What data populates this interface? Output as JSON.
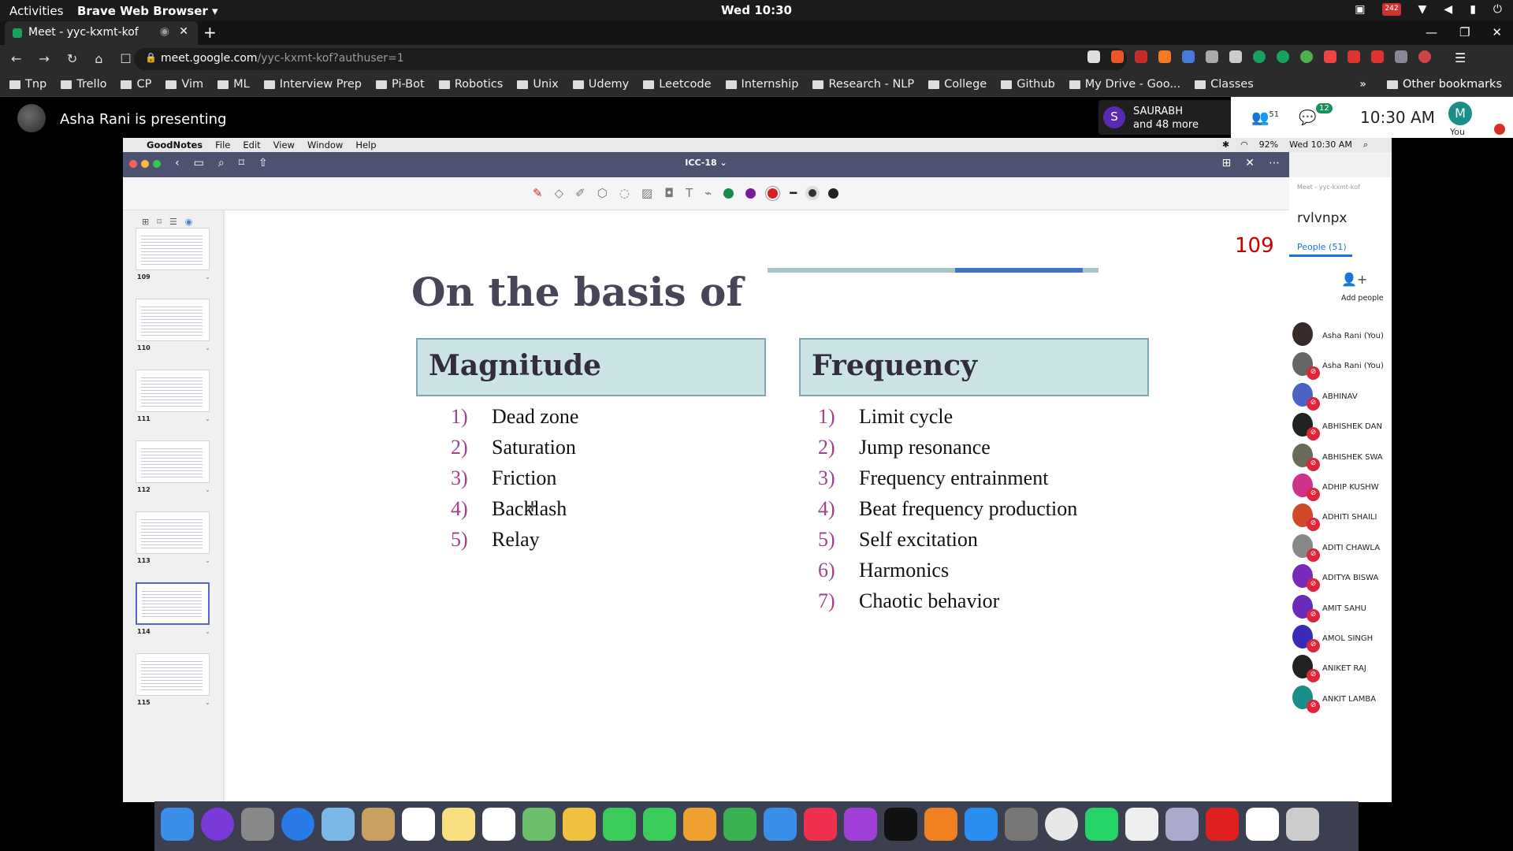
{
  "os_bar": {
    "activities": "Activities",
    "app": "Brave Web Browser ▾",
    "clock": "Wed 10:30",
    "tray_badge": "242"
  },
  "tab": {
    "title": "Meet - yyc-kxmt-kof",
    "close": "✕",
    "new_tab": "+"
  },
  "window_controls": {
    "minimize": "—",
    "maximize": "❐",
    "close": "✕"
  },
  "address": {
    "host": "meet.google.com",
    "path": "/yyc-kxmt-kof?authuser=1"
  },
  "bookmarks": [
    "Tnp",
    "Trello",
    "CP",
    "Vim",
    "ML",
    "Interview Prep",
    "Pi-Bot",
    "Robotics",
    "Unix",
    "Udemy",
    "Leetcode",
    "Internship",
    "Research - NLP",
    "College",
    "Github",
    "My Drive - Goo...",
    "Classes"
  ],
  "bookmarks_more": "»",
  "other_bookmarks": "Other bookmarks",
  "meet": {
    "presenting": "Asha Rani is presenting",
    "speaker_initial": "S",
    "speaker_name": "SAURABH",
    "speaker_more": "and 48 more",
    "people_count": "51",
    "chat_badge": "12",
    "time": "10:30 AM",
    "you_initial": "M",
    "you_label": "You"
  },
  "mac_menu": {
    "app": "GoodNotes",
    "items": [
      "File",
      "Edit",
      "View",
      "Window",
      "Help"
    ],
    "battery": "92%",
    "datetime": "Wed 10:30 AM"
  },
  "goodnotes": {
    "doc_title": "ICC-18 ⌄",
    "page_number": "109",
    "title": "On the basis of",
    "magnitude": {
      "header": "Magnitude",
      "items": [
        {
          "num": "1)",
          "text": "Dead zone"
        },
        {
          "num": "2)",
          "text": "Saturation"
        },
        {
          "num": "3)",
          "text": "Friction"
        },
        {
          "num": "4)",
          "text": "Backlash"
        },
        {
          "num": "5)",
          "text": "Relay"
        }
      ]
    },
    "frequency": {
      "header": "Frequency",
      "items": [
        {
          "num": "1)",
          "text": "Limit cycle"
        },
        {
          "num": "2)",
          "text": "Jump resonance"
        },
        {
          "num": "3)",
          "text": "Frequency entrainment"
        },
        {
          "num": "4)",
          "text": "Beat frequency production"
        },
        {
          "num": "5)",
          "text": "Self excitation"
        },
        {
          "num": "6)",
          "text": "Harmonics"
        },
        {
          "num": "7)",
          "text": "Chaotic behavior"
        }
      ]
    },
    "thumbnails": [
      "109",
      "110",
      "111",
      "112",
      "113",
      "114",
      "115"
    ],
    "selected_thumbnail": "114"
  },
  "participants": {
    "header": "Meet - yyc-kxmt-kof",
    "code_fragment": "rvlvnpx",
    "tab": "People (51)",
    "add_label": "Add people",
    "list": [
      "Asha Rani (You)",
      "Asha Rani (You)",
      "ABHINAV",
      "ABHISHEK DAN",
      "ABHISHEK SWA",
      "ADHIP KUSHW",
      "ADHITI SHAILI",
      "ADITI CHAWLA",
      "ADITYA BISWA",
      "AMIT SAHU",
      "AMOL SINGH",
      "ANIKET RAJ",
      "ANKIT LAMBA"
    ]
  },
  "colors": {
    "title_bar": "#4d5270",
    "box_fill": "#cce3e6",
    "list_number": "#a0448a",
    "page_number": "#c40000",
    "accent_blue": "#3f75c4"
  }
}
